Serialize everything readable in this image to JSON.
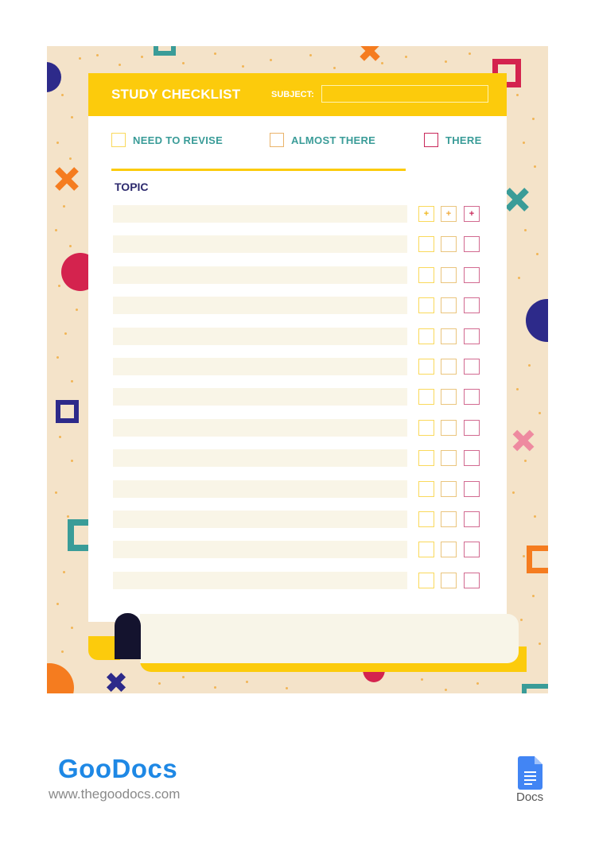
{
  "document": {
    "title": "STUDY CHECKLIST",
    "subject_label": "SUBJECT:",
    "subject_value": "",
    "legend": [
      {
        "label": "NEED TO REVISE",
        "color": "#fccb0c"
      },
      {
        "label": "ALMOST THERE",
        "color": "#f0a93a"
      },
      {
        "label": "THERE",
        "color": "#c8285a"
      }
    ],
    "topic_header": "TOPIC",
    "rows": [
      {
        "topic": "",
        "marks": [
          "+",
          "+",
          "+"
        ]
      },
      {
        "topic": "",
        "marks": [
          "",
          "",
          ""
        ]
      },
      {
        "topic": "",
        "marks": [
          "",
          "",
          ""
        ]
      },
      {
        "topic": "",
        "marks": [
          "",
          "",
          ""
        ]
      },
      {
        "topic": "",
        "marks": [
          "",
          "",
          ""
        ]
      },
      {
        "topic": "",
        "marks": [
          "",
          "",
          ""
        ]
      },
      {
        "topic": "",
        "marks": [
          "",
          "",
          ""
        ]
      },
      {
        "topic": "",
        "marks": [
          "",
          "",
          ""
        ]
      },
      {
        "topic": "",
        "marks": [
          "",
          "",
          ""
        ]
      },
      {
        "topic": "",
        "marks": [
          "",
          "",
          ""
        ]
      },
      {
        "topic": "",
        "marks": [
          "",
          "",
          ""
        ]
      },
      {
        "topic": "",
        "marks": [
          "",
          "",
          ""
        ]
      },
      {
        "topic": "",
        "marks": [
          "",
          "",
          ""
        ]
      }
    ]
  },
  "colors": {
    "accent_yellow": "#fccb0c",
    "teal": "#3a9c98",
    "navy": "#2d2a6e",
    "crimson": "#c8285a",
    "orange": "#f57c1f",
    "background": "#f4e3c9"
  },
  "footer": {
    "brand": "GooDocs",
    "url": "www.thegoodocs.com",
    "app_label": "Docs"
  }
}
